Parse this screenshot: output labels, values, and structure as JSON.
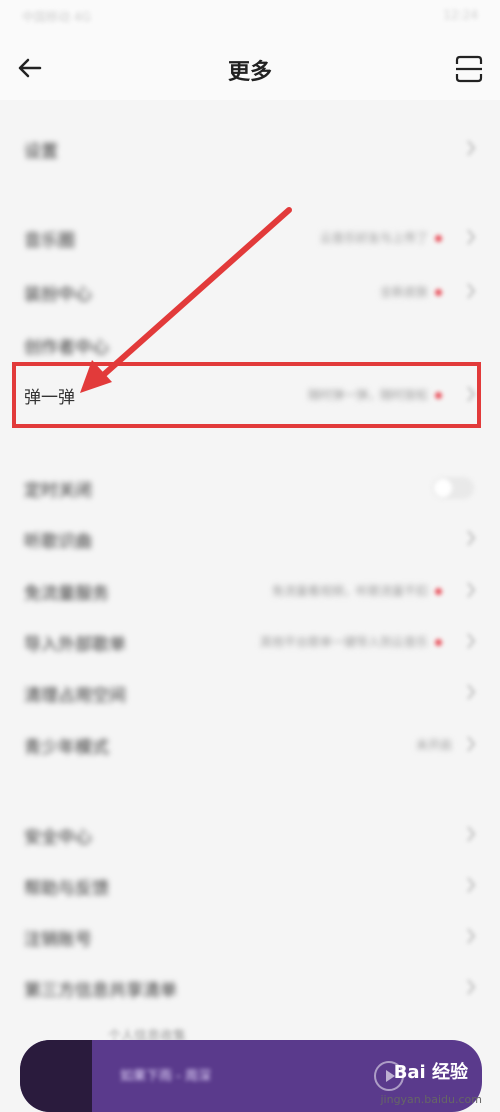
{
  "status_bar": {
    "left": "中国移动 4G",
    "right": "12:24"
  },
  "header": {
    "title": "更多"
  },
  "rows": [
    {
      "label": "设置"
    },
    {
      "label": "音乐圈",
      "value": "云音乐好友与上传了",
      "dot": true
    },
    {
      "label": "装扮中心",
      "value": "全新皮肤",
      "dot": true
    },
    {
      "label": "创作者中心"
    },
    {
      "label": "弹一弹",
      "value": "随时弹一弹，随时放松",
      "dot": true
    },
    {
      "label": "定时关闭",
      "toggle": true,
      "toggle_text": "关"
    },
    {
      "label": "听歌识曲"
    },
    {
      "label": "免流量服务",
      "value": "免流量看视频，听歌流量不扣",
      "dot": true
    },
    {
      "label": "导入外部歌单",
      "value": "其他平台歌单一键导入到云音乐",
      "dot": true
    },
    {
      "label": "清理占用空间"
    },
    {
      "label": "青少年模式",
      "value": "未开启"
    },
    {
      "label": "安全中心"
    },
    {
      "label": "帮助与反馈"
    },
    {
      "label": "注销账号"
    },
    {
      "label": "第三方信息共享清单"
    }
  ],
  "mini_player": {
    "track": "如果下雨 - 周深",
    "peek_text": "个人信息收集"
  },
  "watermark": {
    "brand": "Bai 经验",
    "site": "jingyan.baidu.com"
  },
  "colors": {
    "highlight": "#e23a3a",
    "player_bg": "#5a3a8c",
    "accent_dot": "#e8505b"
  }
}
